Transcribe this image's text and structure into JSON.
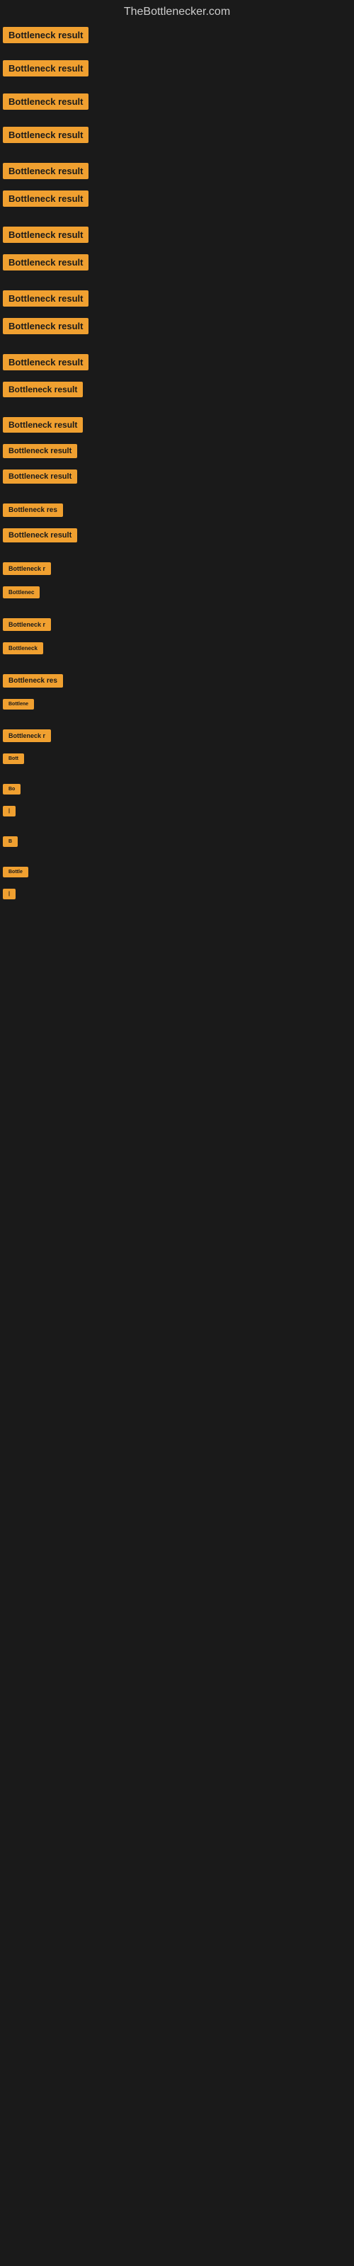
{
  "header": {
    "title": "TheBottlenecker.com"
  },
  "items": [
    {
      "label": "Bottleneck result",
      "size": 100,
      "gap_before": 0
    },
    {
      "label": "Bottleneck result",
      "size": 100,
      "gap_before": 16
    },
    {
      "label": "Bottleneck result",
      "size": 100,
      "gap_before": 16
    },
    {
      "label": "Bottleneck result",
      "size": 100,
      "gap_before": 16
    },
    {
      "label": "Bottleneck result",
      "size": 100,
      "gap_before": 20
    },
    {
      "label": "Bottleneck result",
      "size": 100,
      "gap_before": 8
    },
    {
      "label": "Bottleneck result",
      "size": 100,
      "gap_before": 20
    },
    {
      "label": "Bottleneck result",
      "size": 100,
      "gap_before": 8
    },
    {
      "label": "Bottleneck result",
      "size": 100,
      "gap_before": 20
    },
    {
      "label": "Bottleneck result",
      "size": 100,
      "gap_before": 8
    },
    {
      "label": "Bottleneck result",
      "size": 100,
      "gap_before": 20
    },
    {
      "label": "Bottleneck result",
      "size": 95,
      "gap_before": 8
    },
    {
      "label": "Bottleneck result",
      "size": 90,
      "gap_before": 20
    },
    {
      "label": "Bottleneck result",
      "size": 88,
      "gap_before": 8
    },
    {
      "label": "Bottleneck result",
      "size": 85,
      "gap_before": 8
    },
    {
      "label": "Bottleneck res",
      "size": 80,
      "gap_before": 20
    },
    {
      "label": "Bottleneck result",
      "size": 82,
      "gap_before": 8
    },
    {
      "label": "Bottleneck r",
      "size": 70,
      "gap_before": 20
    },
    {
      "label": "Bottlenec",
      "size": 60,
      "gap_before": 8
    },
    {
      "label": "Bottleneck r",
      "size": 70,
      "gap_before": 20
    },
    {
      "label": "Bottleneck",
      "size": 62,
      "gap_before": 8
    },
    {
      "label": "Bottleneck res",
      "size": 78,
      "gap_before": 20
    },
    {
      "label": "Bottlene",
      "size": 56,
      "gap_before": 8
    },
    {
      "label": "Bottleneck r",
      "size": 68,
      "gap_before": 20
    },
    {
      "label": "Bott",
      "size": 38,
      "gap_before": 8
    },
    {
      "label": "Bo",
      "size": 24,
      "gap_before": 20
    },
    {
      "label": "|",
      "size": 10,
      "gap_before": 8
    },
    {
      "label": "B",
      "size": 16,
      "gap_before": 20
    },
    {
      "label": "Bottle",
      "size": 44,
      "gap_before": 20
    },
    {
      "label": "|",
      "size": 10,
      "gap_before": 8
    }
  ]
}
